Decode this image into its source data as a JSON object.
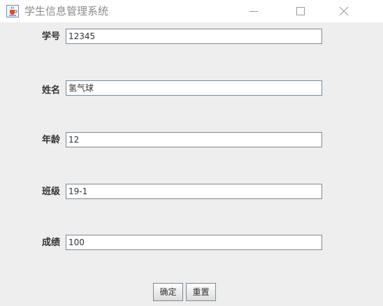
{
  "window": {
    "title": "学生信息管理系统",
    "app_icon": "java-coffee-cup-icon",
    "controls": [
      "minimize-icon",
      "maximize-icon",
      "close-icon"
    ]
  },
  "form": {
    "fields": [
      {
        "label": "学号",
        "value": "12345"
      },
      {
        "label": "姓名",
        "value": "氢气球"
      },
      {
        "label": "年龄",
        "value": "12"
      },
      {
        "label": "班级",
        "value": "19-1"
      },
      {
        "label": "成绩",
        "value": "100"
      }
    ]
  },
  "buttons": {
    "confirm_label": "确定",
    "reset_label": "重置"
  },
  "colors": {
    "window_background": "#eeeeee",
    "titlebar_background": "#ffffff",
    "title_text": "#8b8b8b",
    "input_border": "#7a8a99",
    "text": "#333333"
  }
}
